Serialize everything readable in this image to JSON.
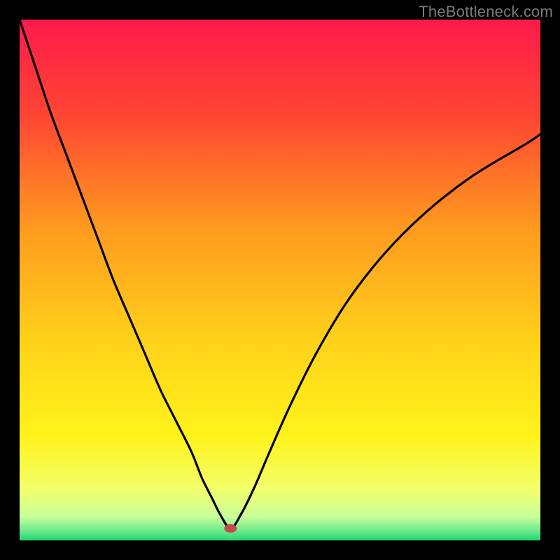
{
  "watermark": "TheBottleneck.com",
  "chart_data": {
    "type": "line",
    "title": "",
    "xlabel": "",
    "ylabel": "",
    "xlim": [
      0,
      100
    ],
    "ylim": [
      0,
      100
    ],
    "grid": false,
    "legend": false,
    "background_gradient": {
      "stops": [
        {
          "offset": 0.0,
          "color": "#ff1a4b"
        },
        {
          "offset": 0.18,
          "color": "#ff4433"
        },
        {
          "offset": 0.4,
          "color": "#ff9a1f"
        },
        {
          "offset": 0.62,
          "color": "#ffd21a"
        },
        {
          "offset": 0.8,
          "color": "#fff31a"
        },
        {
          "offset": 0.9,
          "color": "#f3ff6a"
        },
        {
          "offset": 0.955,
          "color": "#c8ff9a"
        },
        {
          "offset": 0.985,
          "color": "#5fe68a"
        },
        {
          "offset": 1.0,
          "color": "#1fd66a"
        }
      ]
    },
    "marker": {
      "x": 40.5,
      "y": 2.3,
      "color": "#c24a4a",
      "rx": 9,
      "ry": 6
    },
    "series": [
      {
        "name": "bottleneck-curve",
        "x": [
          0,
          3,
          6,
          9,
          12,
          15,
          18,
          21,
          24,
          27,
          30,
          33,
          35,
          37,
          38.5,
          40.5,
          42.5,
          45,
          48,
          52,
          57,
          63,
          70,
          78,
          87,
          97,
          100
        ],
        "values": [
          100,
          91,
          82,
          74,
          66,
          58,
          50,
          43,
          36,
          29,
          23,
          17,
          12,
          8,
          5,
          2.3,
          5,
          10,
          17,
          26,
          36,
          46,
          55,
          63,
          70,
          76,
          78
        ]
      }
    ]
  }
}
